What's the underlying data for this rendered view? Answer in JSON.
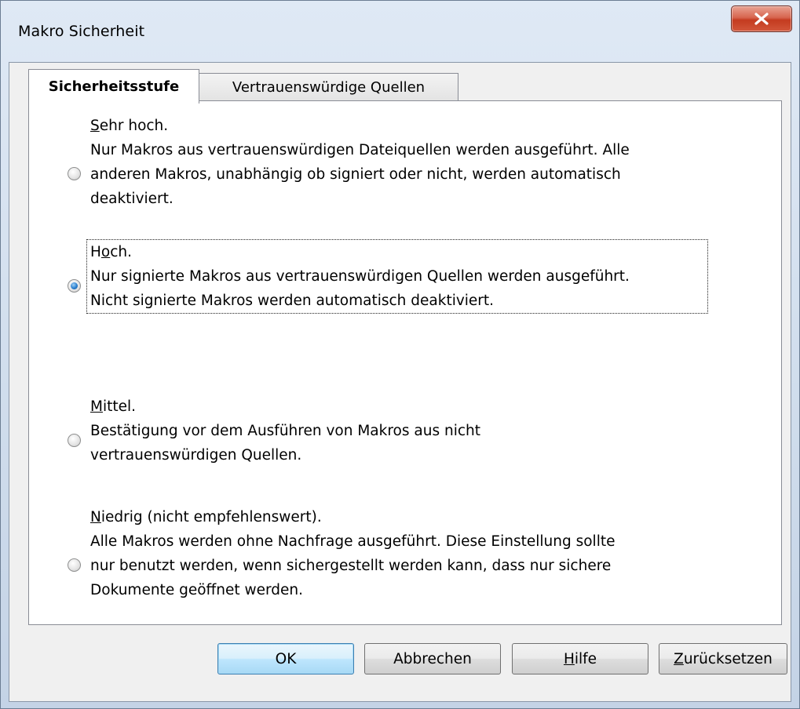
{
  "window": {
    "title": "Makro Sicherheit",
    "close_glyph": "X"
  },
  "tabs": [
    {
      "label": "Sicherheitsstufe",
      "active": true
    },
    {
      "label": "Vertrauenswürdige Quellen",
      "active": false
    }
  ],
  "security_levels": [
    {
      "mnemonic": "S",
      "title_rest": "ehr hoch.",
      "lines": [
        "Nur Makros aus vertrauenswürdigen Dateiquellen werden ausgeführt. Alle",
        "anderen Makros, unabhängig ob signiert oder nicht, werden automatisch",
        "deaktiviert."
      ],
      "checked": false
    },
    {
      "title_pre": "H",
      "mnemonic": "o",
      "title_rest": "ch.",
      "lines": [
        "Nur signierte Makros aus vertrauenswürdigen Quellen werden ausgeführt.",
        "Nicht signierte Makros werden automatisch deaktiviert."
      ],
      "checked": true
    },
    {
      "mnemonic": "M",
      "title_rest": "ittel.",
      "lines": [
        "Bestätigung vor dem Ausführen von Makros aus nicht",
        "vertrauenswürdigen Quellen."
      ],
      "checked": false
    },
    {
      "mnemonic": "N",
      "title_rest": "iedrig (nicht empfehlenswert).",
      "lines": [
        "Alle Makros werden ohne Nachfrage ausgeführt. Diese Einstellung sollte",
        "nur benutzt werden, wenn sichergestellt werden kann, dass nur sichere",
        "Dokumente geöffnet werden."
      ],
      "checked": false
    }
  ],
  "buttons": {
    "ok": {
      "label": "OK"
    },
    "cancel": {
      "label": "Abbrechen"
    },
    "help": {
      "mnemonic": "H",
      "rest": "ilfe"
    },
    "reset": {
      "mnemonic": "Z",
      "rest": "urücksetzen"
    }
  },
  "colors": {
    "accent_radio": "#2a7fcf",
    "close_button": "#c43b1f",
    "default_button": "#a7d9f5"
  }
}
